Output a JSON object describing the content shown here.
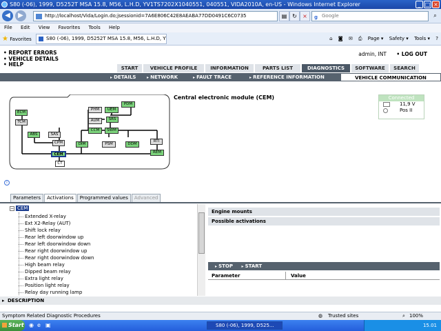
{
  "window": {
    "title": "S80 (-06), 1999, D5252T MSA 15.8, M56, L.H.D, YV1TS7202X1040551, 040551, VIDA2010A, en-US - Windows Internet Explorer"
  },
  "address_bar": {
    "url": "http://localhost/Vida/Login.do;jsessionid=7A6E806C42E8AEABA77DD0491C6C0735",
    "search_placeholder": "Google"
  },
  "menu": [
    "File",
    "Edit",
    "View",
    "Favorites",
    "Tools",
    "Help"
  ],
  "favorites_label": "Favorites",
  "browser_tab": "S80 (-06), 1999, D5252T MSA 15.8, M56, L.H.D, YV1T...",
  "command_bar": [
    "Page ▾",
    "Safety ▾",
    "Tools ▾",
    "?"
  ],
  "top_links": [
    "REPORT ERRORS",
    "VEHICLE DETAILS",
    "HELP"
  ],
  "user": {
    "name": "admin, INT",
    "logout": "LOG OUT"
  },
  "main_tabs": [
    {
      "label": "START",
      "active": false
    },
    {
      "label": "VEHICLE PROFILE",
      "active": false
    },
    {
      "label": "INFORMATION",
      "active": false
    },
    {
      "label": "PARTS LIST",
      "active": false
    },
    {
      "label": "DIAGNOSTICS",
      "active": true
    },
    {
      "label": "SOFTWARE",
      "active": false
    },
    {
      "label": "SEARCH",
      "active": false
    }
  ],
  "sub_tabs": [
    "DETAILS",
    "NETWORK",
    "FAULT TRACE",
    "REFERENCE INFORMATION"
  ],
  "sub_active": "VEHICLE COMMUNICATION",
  "module_title": "Central electronic module (CEM)",
  "diagram_nodes": [
    {
      "label": "ECM",
      "state": "green"
    },
    {
      "label": "TCM",
      "state": "grey"
    },
    {
      "label": "ABS",
      "state": "green"
    },
    {
      "label": "SAS",
      "state": "grey"
    },
    {
      "label": "CPM",
      "state": "grey"
    },
    {
      "label": "CEM",
      "state": "selected"
    },
    {
      "label": "CT",
      "state": "white"
    },
    {
      "label": "PHM",
      "state": "grey"
    },
    {
      "label": "AUM",
      "state": "grey"
    },
    {
      "label": "CCM",
      "state": "green"
    },
    {
      "label": "DIM",
      "state": "green"
    },
    {
      "label": "UEM",
      "state": "green"
    },
    {
      "label": "SRS",
      "state": "green"
    },
    {
      "label": "SWM",
      "state": "green"
    },
    {
      "label": "PDM",
      "state": "green"
    },
    {
      "label": "PSM",
      "state": "grey"
    },
    {
      "label": "DDM",
      "state": "green"
    },
    {
      "label": "RTI",
      "state": "grey"
    },
    {
      "label": "REM",
      "state": "green"
    }
  ],
  "connection": {
    "status": "Connected",
    "voltage": "11,9 V",
    "ignition": "Pos II"
  },
  "lower_tabs": [
    {
      "label": "Parameters",
      "state": "normal"
    },
    {
      "label": "Activations",
      "state": "active"
    },
    {
      "label": "Programmed values",
      "state": "normal"
    },
    {
      "label": "Advanced",
      "state": "disabled"
    }
  ],
  "tree": {
    "expander": "−",
    "root": "CEM",
    "items": [
      "Extended X-relay",
      "Ext X2-Relay (AUT)",
      "Shift lock relay",
      "Rear left doorwindow up",
      "Rear left doorwindow down",
      "Rear right doorwindow up",
      "Rear right doorwindow down",
      "High beam relay",
      "Dipped beam relay",
      "Extra light relay",
      "Position light relay",
      "Relay day running lamp"
    ]
  },
  "right_panel": {
    "header": "Engine mounts",
    "possible": "Possible activations",
    "stop": "STOP",
    "start": "START",
    "col_parameter": "Parameter",
    "col_value": "Value"
  },
  "description_label": "DESCRIPTION",
  "statusbar": {
    "text": "Symptom Related Diagnostic Procedures",
    "zone": "Trusted sites",
    "zoom": "100%"
  },
  "taskbar": {
    "start": "Start",
    "window": "S80 (-06), 1999, D525...",
    "clock": "15.01"
  }
}
